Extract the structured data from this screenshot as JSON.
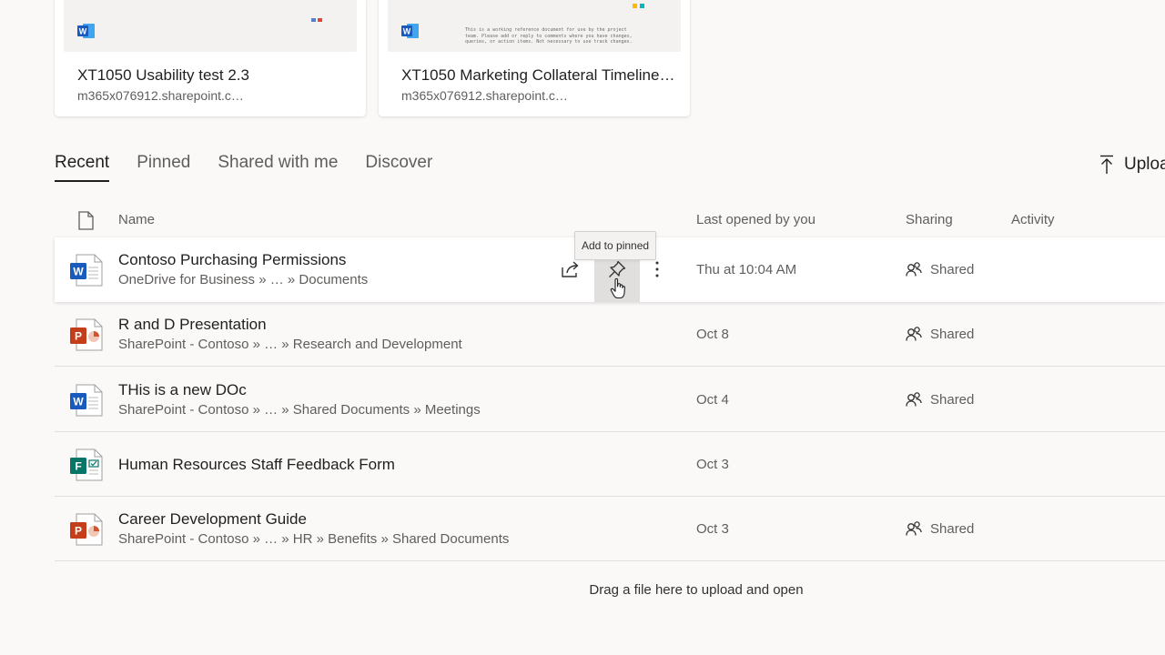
{
  "recommended": [
    {
      "title": "XT1050 Usability test 2.3",
      "location": "m365x076912.sharepoint.c…",
      "thumb_colors": [
        "#5b7fc4",
        "#e0473a"
      ]
    },
    {
      "title": "XT1050 Marketing Collateral Timeline…",
      "location": "m365x076912.sharepoint.c…",
      "thumb_text": "This is a working reference document for use by the project team. Please add or reply to comments where you have changes, queries, or action items. Not necessary to use track changes.",
      "thumb_colors": [
        "#ffb900",
        "#00b7c3"
      ]
    }
  ],
  "tabs": [
    "Recent",
    "Pinned",
    "Shared with me",
    "Discover"
  ],
  "active_tab": "Recent",
  "upload_label": "Uploa",
  "columns": {
    "name": "Name",
    "last_opened": "Last opened by you",
    "sharing": "Sharing",
    "activity": "Activity"
  },
  "files": [
    {
      "name": "Contoso Purchasing Permissions",
      "path": "OneDrive for Business » … » Documents",
      "last_opened": "Thu at 10:04 AM",
      "sharing": "Shared",
      "type": "word",
      "hovered": true
    },
    {
      "name": "R and D Presentation",
      "path": "SharePoint - Contoso » … » Research and Development",
      "last_opened": "Oct 8",
      "sharing": "Shared",
      "type": "powerpoint"
    },
    {
      "name": "THis is a new DOc",
      "path": "SharePoint - Contoso » … » Shared Documents » Meetings",
      "last_opened": "Oct 4",
      "sharing": "Shared",
      "type": "word"
    },
    {
      "name": "Human Resources Staff Feedback Form",
      "path": "",
      "last_opened": "Oct 3",
      "sharing": "",
      "type": "forms"
    },
    {
      "name": "Career Development Guide",
      "path": "SharePoint - Contoso » … » HR » Benefits » Shared Documents",
      "last_opened": "Oct 3",
      "sharing": "Shared",
      "type": "powerpoint"
    }
  ],
  "tooltip": "Add to pinned",
  "drop_hint": "Drag a file here to upload and open",
  "icons": {
    "header": "document-icon",
    "share": "share-icon",
    "pin": "pin-icon",
    "more": "more-vertical-icon",
    "shared": "people-icon",
    "upload": "upload-icon",
    "cursor": "hand-pointer-icon"
  },
  "colors": {
    "word": "#185abd",
    "powerpoint": "#c43e1c",
    "forms": "#077568",
    "background": "#faf9f8"
  }
}
